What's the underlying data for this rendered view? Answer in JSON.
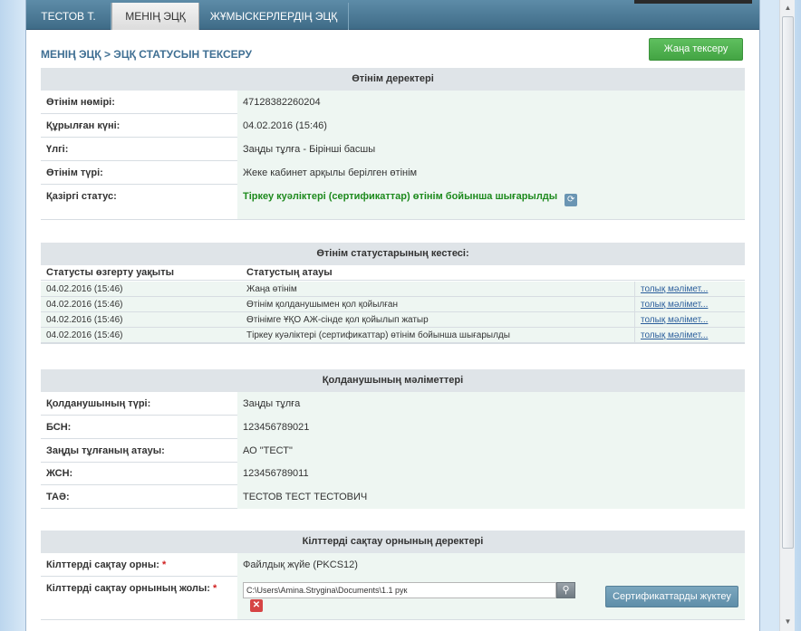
{
  "nav": {
    "tabs": [
      {
        "label": "ТЕСТОВ Т."
      },
      {
        "label": "МЕНІҢ ЭЦҚ"
      },
      {
        "label": "ЖҰМЫСКЕРЛЕРДІҢ ЭЦҚ"
      }
    ],
    "active_tab": 1
  },
  "page": {
    "breadcrumb": "МЕНІҢ ЭЦҚ > ЭЦҚ СТАТУСЫН ТЕКСЕРУ",
    "new_check_button": "Жаңа тексеру"
  },
  "application": {
    "title": "Өтінім деректері",
    "rows": [
      {
        "label": "Өтінім нөмірі:",
        "value": "47128382260204"
      },
      {
        "label": "Құрылған күні:",
        "value": "04.02.2016 (15:46)"
      },
      {
        "label": "Үлгі:",
        "value": "Заңды тұлға - Бірінші басшы"
      },
      {
        "label": "Өтінім түрі:",
        "value": "Жеке кабинет арқылы берілген өтінім"
      }
    ],
    "current_status_label": "Қазіргі статус:",
    "current_status_value": "Тіркеу куәліктері (сертификаттар) өтінім бойынша шығарылды"
  },
  "history": {
    "title": "Өтінім статустарының кестесі:",
    "col_time": "Статусты өзгерту уақыты",
    "col_name": "Статустың атауы",
    "rows": [
      {
        "time": "04.02.2016 (15:46)",
        "name": "Жаңа өтінім",
        "link": "толық мәлімет..."
      },
      {
        "time": "04.02.2016 (15:46)",
        "name": "Өтінім қолданушымен қол қойылған",
        "link": "толық мәлімет..."
      },
      {
        "time": "04.02.2016 (15:46)",
        "name": "Өтінімге ҰҚО АЖ-сінде қол қойылып жатыр",
        "link": "толық мәлімет..."
      },
      {
        "time": "04.02.2016 (15:46)",
        "name": "Тіркеу куәліктері (сертификаттар) өтінім бойынша шығарылды",
        "link": "толық мәлімет..."
      }
    ]
  },
  "user": {
    "title": "Қолданушының мәліметтері",
    "rows": [
      {
        "label": "Қолданушының түрі:",
        "value": "Заңды тұлға"
      },
      {
        "label": "БСН:",
        "value": "123456789021"
      },
      {
        "label": "Заңды тұлғаның атауы:",
        "value": "АО \"ТЕСТ\""
      },
      {
        "label": "ЖСН:",
        "value": "123456789011"
      },
      {
        "label": "ТАӘ:",
        "value": "ТЕСТОВ ТЕСТ ТЕСТОВИЧ"
      }
    ]
  },
  "keystore": {
    "title": "Кілттерді сақтау орнының деректері",
    "location_label": "Кілттерді сақтау орны:",
    "location_value": "Файлдық жүйе (PKCS12)",
    "path_label": "Кілттерді сақтау орнының жолы:",
    "path_value": "C:\\Users\\Amina.Strygina\\Documents\\1.1 рук",
    "load_button": "Сертификаттарды жүктеу",
    "required_mark": "*"
  },
  "icons": {
    "search": "search-icon",
    "delete": "delete-icon",
    "refresh": "refresh-icon"
  },
  "colors": {
    "accent": "#3f6f93",
    "status_green": "#1d8a1d",
    "button_green": "#4cad4c"
  }
}
